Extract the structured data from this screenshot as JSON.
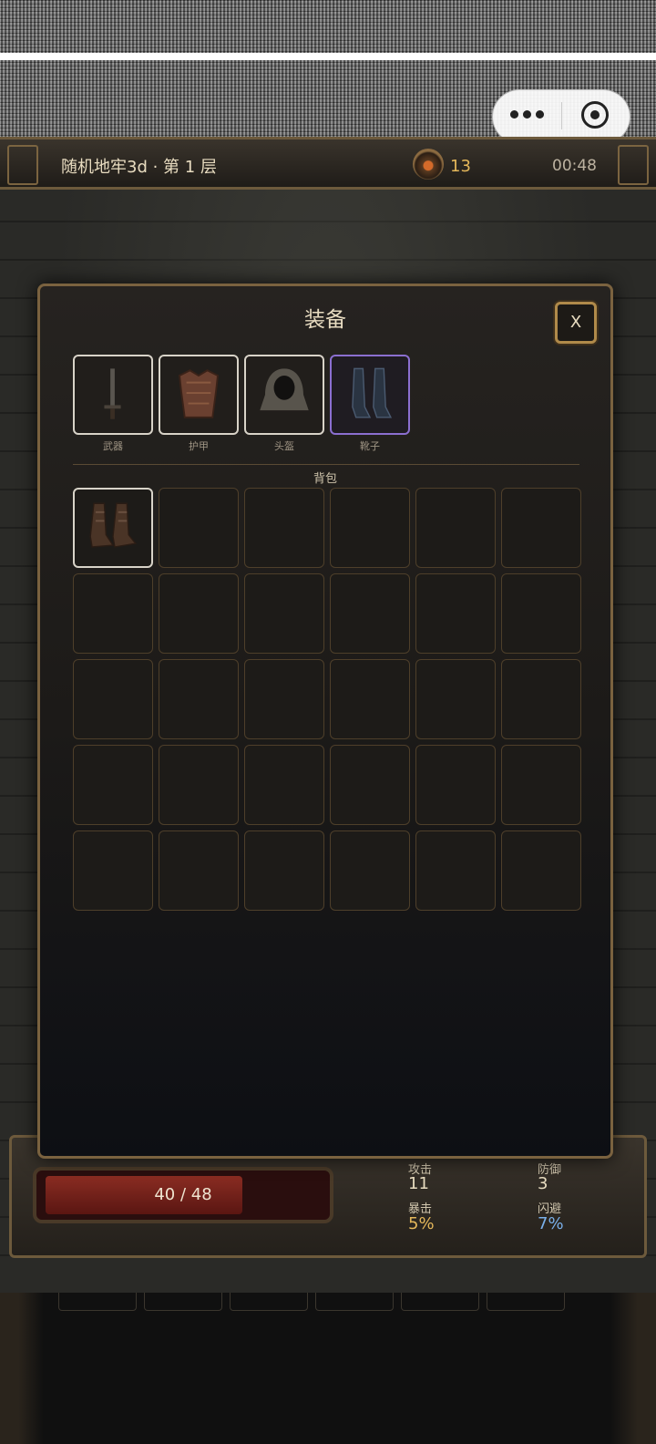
{
  "game": {
    "title": "随机地牢3d · 第 1 层",
    "gold": "13",
    "timer": "00:48"
  },
  "hud": {
    "hp": "40 / 48",
    "hp_fraction": 0.83,
    "attack_label": "攻击",
    "attack_value": "11",
    "defense_label": "防御",
    "defense_value": "3",
    "crit_label": "暴击",
    "crit_value": "5%",
    "dodge_label": "闪避",
    "dodge_value": "7%",
    "crit_color": "#e4b75a",
    "dodge_color": "#7ab0ea"
  },
  "modal": {
    "title": "装备",
    "close_label": "X",
    "equipment": [
      {
        "label": "武器",
        "icon": "sword-icon",
        "state": "equipped"
      },
      {
        "label": "护甲",
        "icon": "chest-armor-icon",
        "state": "equipped"
      },
      {
        "label": "头盔",
        "icon": "hood-icon",
        "state": "equipped"
      },
      {
        "label": "靴子",
        "icon": "boots-icon",
        "state": "equipped-rare"
      }
    ],
    "bag_title": "背包",
    "bag": {
      "rows": 5,
      "cols": 6,
      "items": [
        {
          "index": 0,
          "icon": "leather-boots-icon"
        }
      ]
    }
  },
  "colors": {
    "frame_gold": "#7a623f",
    "rare_purple": "#8b6fd0",
    "gold_text": "#e4b75a"
  }
}
